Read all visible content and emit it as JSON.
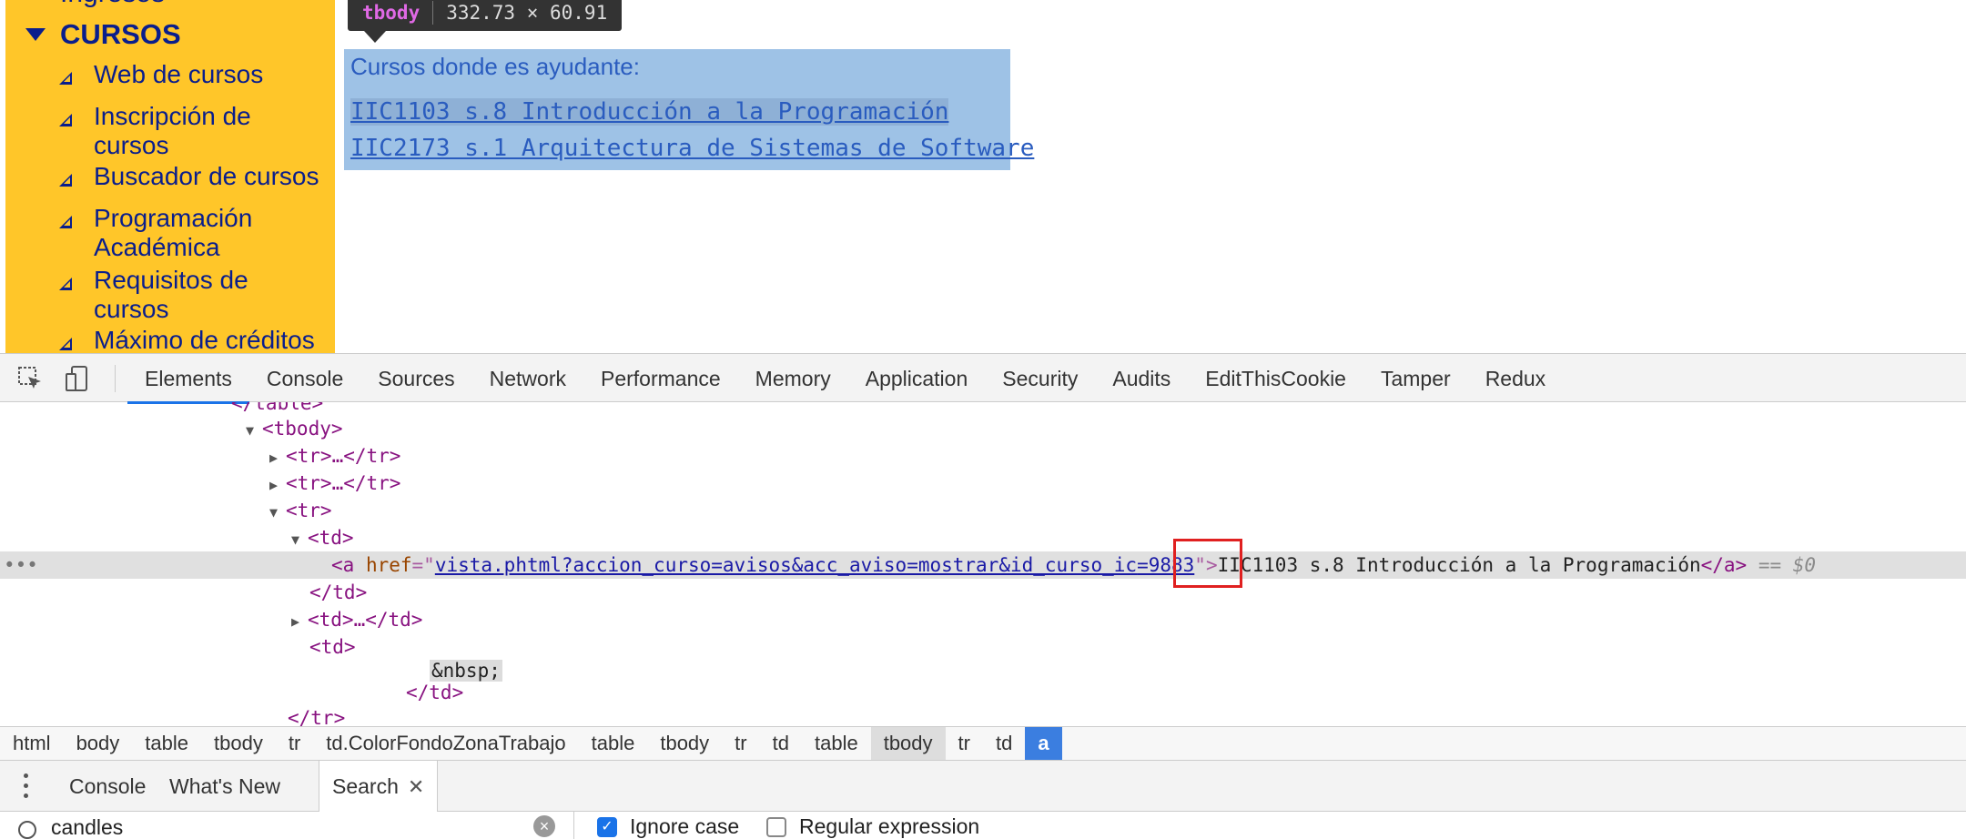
{
  "sidebar": {
    "cut_item": "Ingresos",
    "section_title": "CURSOS",
    "items": [
      {
        "label": "Web de cursos"
      },
      {
        "label": "Inscripción de cursos"
      },
      {
        "label": "Buscador de cursos"
      },
      {
        "label": "Programación Académica"
      },
      {
        "label": "Requisitos de cursos"
      },
      {
        "label": "Máximo de créditos"
      }
    ]
  },
  "tooltip": {
    "tag": "tbody",
    "dims": "332.73 × 60.91"
  },
  "content": {
    "title": "Cursos donde es ayudante:",
    "links": [
      "IIC1103 s.8 Introducción a la Programación",
      "IIC2173 s.1 Arquitectura de Sistemas de Software"
    ]
  },
  "devtools": {
    "tabs": [
      "Elements",
      "Console",
      "Sources",
      "Network",
      "Performance",
      "Memory",
      "Application",
      "Security",
      "Audits",
      "EditThisCookie",
      "Tamper",
      "Redux"
    ],
    "active_tab": "Elements",
    "dom": {
      "table_close": "</table>",
      "tbody": "<tbody>",
      "tr_collapsed": "<tr>…</tr>",
      "tr_open": "<tr>",
      "td_open": "<td>",
      "a_open": "<a",
      "attr_name": "href",
      "attr_value_pre": "vista.phtml?accion_curso=avisos&acc_aviso=mostrar&id_curso_ic",
      "attr_value_id": "=9883",
      "link_text": "IIC1103 s.8 Introducción a la Programación",
      "a_close": "</a>",
      "dollar": "== $0",
      "td_close": "</td>",
      "td_collapsed": "<td>…</td>",
      "nbsp": "&nbsp;",
      "tr_close": "</tr>",
      "dots": "•••"
    },
    "breadcrumbs": [
      "html",
      "body",
      "table",
      "tbody",
      "tr",
      "td.ColorFondoZonaTrabajo",
      "table",
      "tbody",
      "tr",
      "td",
      "table",
      "tbody",
      "tr",
      "td",
      "a"
    ],
    "drawer": {
      "tabs": [
        "Console",
        "What's New",
        "Search"
      ],
      "active": "Search",
      "search_value": "candles",
      "ignore_case_label": "Ignore case",
      "regex_label": "Regular expression"
    }
  },
  "colors": {
    "sidebar_bg": "#ffc629",
    "sidebar_text": "#0a1e8c",
    "highlight": "#9ec2e6",
    "accent": "#1a73e8",
    "marker": "#e02020"
  }
}
